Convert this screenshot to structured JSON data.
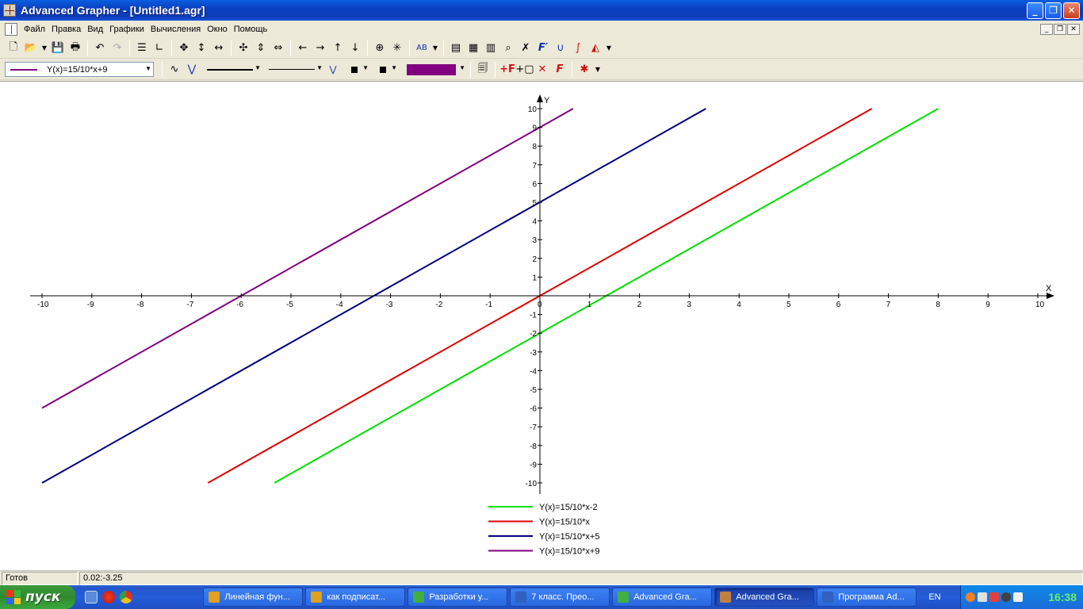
{
  "window": {
    "title": "Advanced Grapher - [Untitled1.agr]",
    "minimize": "_",
    "maximize": "❐",
    "close": "✕"
  },
  "menu": {
    "items": [
      "Файл",
      "Правка",
      "Вид",
      "Графики",
      "Вычисления",
      "Окно",
      "Помощь"
    ],
    "mdi": [
      "_",
      "❐",
      "✕"
    ]
  },
  "toolbar2": {
    "selected_function": "Y(x)=15/10*x+9",
    "color": "#800080"
  },
  "chart_data": {
    "type": "line",
    "xlabel": "X",
    "ylabel": "Y",
    "xlim": [
      -10,
      10
    ],
    "ylim": [
      -10,
      10
    ],
    "x_ticks": [
      "-10",
      "-9",
      "-8",
      "-7",
      "-6",
      "-5",
      "-4",
      "-3",
      "-2",
      "-1",
      "0",
      "1",
      "2",
      "3",
      "4",
      "5",
      "6",
      "7",
      "8",
      "9",
      "10"
    ],
    "y_ticks": [
      "10",
      "9",
      "8",
      "7",
      "6",
      "5",
      "4",
      "3",
      "2",
      "1",
      "-1",
      "-2",
      "-3",
      "-4",
      "-5",
      "-6",
      "-7",
      "-8",
      "-9",
      "-10"
    ],
    "series": [
      {
        "name": "Y(x)=15/10*x-2",
        "color": "#00e000",
        "slope": 1.5,
        "intercept": -2
      },
      {
        "name": "Y(x)=15/10*x",
        "color": "#e00000",
        "slope": 1.5,
        "intercept": 0
      },
      {
        "name": "Y(x)=15/10*x+5",
        "color": "#000080",
        "slope": 1.5,
        "intercept": 5
      },
      {
        "name": "Y(x)=15/10*x+9",
        "color": "#800080",
        "slope": 1.5,
        "intercept": 9
      }
    ]
  },
  "status": {
    "state": "Готов",
    "coords": "0.02:-3.25"
  },
  "taskbar": {
    "start": "пуск",
    "tasks": [
      {
        "label": "Линейная фун...",
        "icon": "#e0a020"
      },
      {
        "label": "как подписат...",
        "icon": "#e0a020"
      },
      {
        "label": "Разработки у...",
        "icon": "#40b040"
      },
      {
        "label": "7 класс. Прео...",
        "icon": "#3060c0"
      },
      {
        "label": "Advanced Gra...",
        "icon": "#40b040"
      },
      {
        "label": "Advanced Gra...",
        "icon": "#c08040"
      },
      {
        "label": "Программа Ad...",
        "icon": "#3060c0"
      }
    ],
    "lang": "EN",
    "clock": "16:38"
  }
}
